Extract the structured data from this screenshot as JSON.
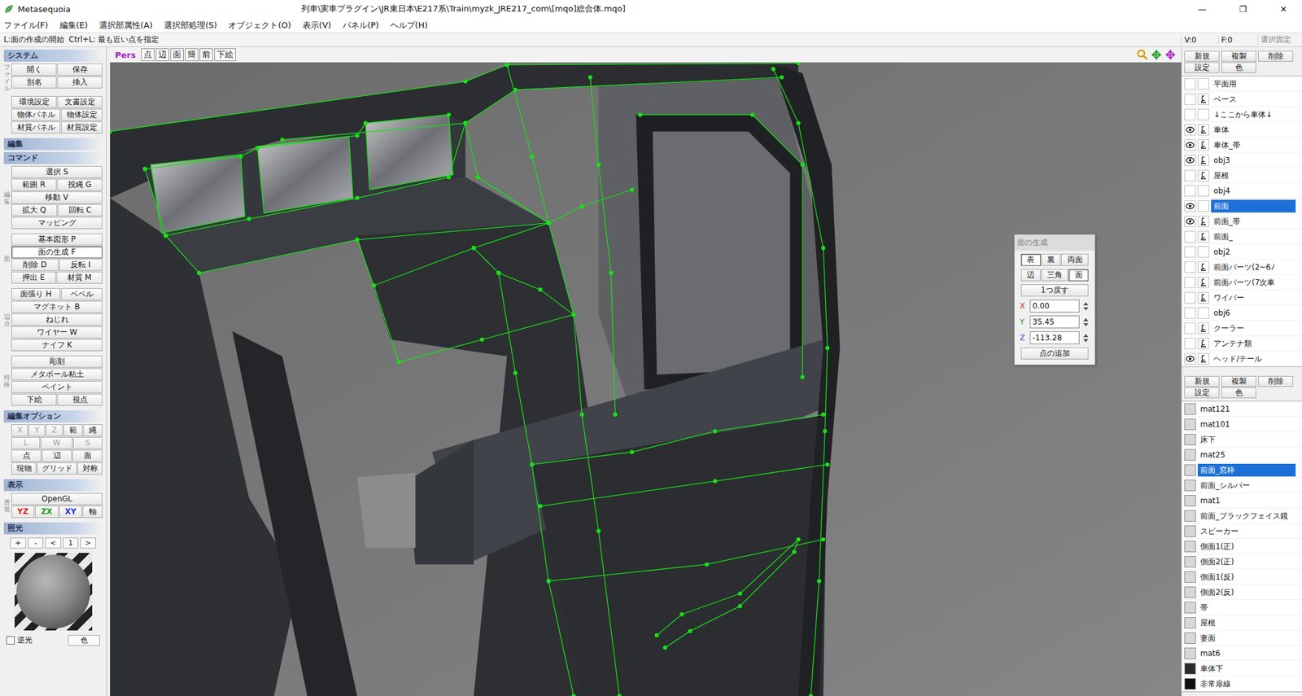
{
  "window": {
    "app": "Metasequoia",
    "path": "列車\\実車プラグイン\\JR東日本\\E217系\\Train\\myzk_JRE217_com\\[mqo]総合体.mqo]",
    "controls": [
      "—",
      "❐",
      "✕"
    ]
  },
  "menu": [
    "ファイル(F)",
    "編集(E)",
    "選択部属性(A)",
    "選択部処理(S)",
    "オブジェクト(O)",
    "表示(V)",
    "パネル(P)",
    "ヘルプ(H)"
  ],
  "status": {
    "hint": "L:面の作成の開始  Ctrl+L: 最も近い点を指定",
    "vertices": "V:0",
    "faces": "F:0",
    "lock": "選択固定"
  },
  "left_panel": {
    "sections": [
      {
        "title": "システム",
        "subtitle": "",
        "groups": [
          {
            "label": "ファイル",
            "rows": [
              [
                {
                  "label": "開く",
                  "selected": false,
                  "disabled": false
                },
                {
                  "label": "保存",
                  "selected": false,
                  "disabled": false
                }
              ],
              [
                {
                  "label": "別名",
                  "selected": false,
                  "disabled": false
                },
                {
                  "label": "挿入",
                  "selected": false,
                  "disabled": false
                }
              ]
            ]
          },
          {
            "label": "",
            "rows": [
              [
                {
                  "label": "環境設定",
                  "selected": false,
                  "disabled": false
                },
                {
                  "label": "文書設定",
                  "selected": false,
                  "disabled": false
                }
              ],
              [
                {
                  "label": "物体パネル",
                  "selected": false,
                  "disabled": false
                },
                {
                  "label": "物体設定",
                  "selected": false,
                  "disabled": false
                }
              ],
              [
                {
                  "label": "材質パネル",
                  "selected": false,
                  "disabled": false
                },
                {
                  "label": "材質設定",
                  "selected": false,
                  "disabled": false
                }
              ]
            ]
          }
        ]
      },
      {
        "title": "編集",
        "subtitle": "コマンド",
        "groups": [
          {
            "label": "編集",
            "rows": [
              [
                {
                  "label": "選択 S",
                  "selected": false,
                  "disabled": false
                }
              ],
              [
                {
                  "label": "範囲 R",
                  "selected": false,
                  "disabled": false
                },
                {
                  "label": "投縄 G",
                  "selected": false,
                  "disabled": false
                }
              ],
              [
                {
                  "label": "移動 V",
                  "selected": false,
                  "disabled": false
                }
              ],
              [
                {
                  "label": "拡大 Q",
                  "selected": false,
                  "disabled": false
                },
                {
                  "label": "回転 C",
                  "selected": false,
                  "disabled": false
                }
              ],
              [
                {
                  "label": "マッピング",
                  "selected": false,
                  "disabled": false
                }
              ]
            ]
          },
          {
            "label": "面",
            "rows": [
              [
                {
                  "label": "基本図形 P",
                  "selected": false,
                  "disabled": false
                }
              ],
              [
                {
                  "label": "面の生成 F",
                  "selected": true,
                  "disabled": false
                }
              ],
              [
                {
                  "label": "削除 D",
                  "selected": false,
                  "disabled": false
                },
                {
                  "label": "反転 I",
                  "selected": false,
                  "disabled": false
                }
              ],
              [
                {
                  "label": "押出 E",
                  "selected": false,
                  "disabled": false
                },
                {
                  "label": "材質 M",
                  "selected": false,
                  "disabled": false
                }
              ]
            ]
          },
          {
            "label": "辺・点",
            "rows": [
              [
                {
                  "label": "面張り H",
                  "selected": false,
                  "disabled": false
                },
                {
                  "label": "ベベル",
                  "selected": false,
                  "disabled": false
                }
              ],
              [
                {
                  "label": "マグネット B",
                  "selected": false,
                  "disabled": false
                }
              ],
              [
                {
                  "label": "ねじれ",
                  "selected": false,
                  "disabled": false
                }
              ],
              [
                {
                  "label": "ワイヤー W",
                  "selected": false,
                  "disabled": false
                }
              ],
              [
                {
                  "label": "ナイフ K",
                  "selected": false,
                  "disabled": false
                }
              ]
            ]
          },
          {
            "label": "特殊",
            "rows": [
              [
                {
                  "label": "彫刻",
                  "selected": false,
                  "disabled": false
                }
              ],
              [
                {
                  "label": "メタボール粘土",
                  "selected": false,
                  "disabled": false
                }
              ],
              [
                {
                  "label": "ペイント",
                  "selected": false,
                  "disabled": false
                }
              ],
              [
                {
                  "label": "下絵",
                  "selected": false,
                  "disabled": false
                },
                {
                  "label": "視点",
                  "selected": false,
                  "disabled": false
                }
              ]
            ]
          }
        ]
      },
      {
        "title": "編集オプション",
        "subtitle": "",
        "groups": [
          {
            "label": "",
            "rows": [
              [
                {
                  "label": "X",
                  "selected": false,
                  "disabled": true
                },
                {
                  "label": "Y",
                  "selected": false,
                  "disabled": true
                },
                {
                  "label": "Z",
                  "selected": false,
                  "disabled": true
                },
                {
                  "label": "範",
                  "selected": false,
                  "disabled": false
                },
                {
                  "label": "縄",
                  "selected": false,
                  "disabled": false
                }
              ],
              [
                {
                  "label": "L",
                  "selected": false,
                  "disabled": true
                },
                {
                  "label": "W",
                  "selected": false,
                  "disabled": true
                },
                {
                  "label": "S",
                  "selected": false,
                  "disabled": true
                }
              ],
              [
                {
                  "label": "点",
                  "selected": false,
                  "disabled": false
                },
                {
                  "label": "辺",
                  "selected": false,
                  "disabled": false
                },
                {
                  "label": "面",
                  "selected": false,
                  "disabled": false
                }
              ],
              [
                {
                  "label": "現物",
                  "selected": false,
                  "disabled": false
                },
                {
                  "label": "グリッド",
                  "selected": false,
                  "disabled": false
                },
                {
                  "label": "対称",
                  "selected": false,
                  "disabled": false
                }
              ]
            ]
          }
        ]
      },
      {
        "title": "表示",
        "subtitle": "",
        "groups": [
          {
            "label": "透視",
            "rows": [
              [
                {
                  "label": "OpenGL",
                  "selected": false,
                  "disabled": false
                }
              ],
              [
                {
                  "label": "YZ",
                  "selected": false,
                  "disabled": false,
                  "color": "#e02020"
                },
                {
                  "label": "ZX",
                  "selected": false,
                  "disabled": false,
                  "color": "#18a018"
                },
                {
                  "label": "XY",
                  "selected": false,
                  "disabled": false,
                  "color": "#2030e0"
                },
                {
                  "label": "軸",
                  "selected": false,
                  "disabled": false
                }
              ]
            ]
          }
        ]
      }
    ],
    "lighting": {
      "title": "照光",
      "controls": [
        "+",
        "-",
        "<",
        "1",
        ">"
      ],
      "backlight": {
        "label": "逆光",
        "checked": false
      },
      "color_button": "色"
    }
  },
  "viewport": {
    "view": "Pers",
    "buttons": [
      {
        "label": "点",
        "selected": false
      },
      {
        "label": "辺",
        "selected": false
      },
      {
        "label": "面",
        "selected": false
      },
      {
        "label": "簡",
        "selected": false
      },
      {
        "label": "前",
        "selected": false
      },
      {
        "label": "下絵",
        "selected": false
      }
    ]
  },
  "face_panel": {
    "title": "面の生成",
    "sides": [
      {
        "label": "表",
        "selected": true
      },
      {
        "label": "裏",
        "selected": false
      },
      {
        "label": "両面",
        "selected": false
      }
    ],
    "modes": [
      {
        "label": "辺",
        "selected": false
      },
      {
        "label": "三角",
        "selected": false
      },
      {
        "label": "面",
        "selected": true
      }
    ],
    "undo": "1つ戻す",
    "coords": [
      {
        "axis": "X",
        "value": "0.00",
        "color": "#e03030"
      },
      {
        "axis": "Y",
        "value": "35.45",
        "color": "#28a028"
      },
      {
        "axis": "Z",
        "value": "-113.28",
        "color": "#3050e0"
      }
    ],
    "add": "点の追加"
  },
  "objects": {
    "buttons": [
      "新規",
      "複製",
      "削除",
      "設定",
      "色"
    ],
    "items": [
      {
        "name": "平面用",
        "visible": false,
        "locked": false,
        "selected": false
      },
      {
        "name": "ベース",
        "visible": false,
        "locked": true,
        "selected": false
      },
      {
        "name": "↓ここから車体↓",
        "visible": false,
        "locked": false,
        "selected": false
      },
      {
        "name": "車体",
        "visible": true,
        "locked": true,
        "selected": false
      },
      {
        "name": "車体_帯",
        "visible": true,
        "locked": true,
        "selected": false
      },
      {
        "name": "obj3",
        "visible": true,
        "locked": true,
        "selected": false
      },
      {
        "name": "屋根",
        "visible": false,
        "locked": true,
        "selected": false
      },
      {
        "name": "obj4",
        "visible": false,
        "locked": false,
        "selected": false
      },
      {
        "name": "前面",
        "visible": true,
        "locked": false,
        "selected": true
      },
      {
        "name": "前面_帯",
        "visible": true,
        "locked": true,
        "selected": false
      },
      {
        "name": "前面_",
        "visible": false,
        "locked": true,
        "selected": false
      },
      {
        "name": "obj2",
        "visible": false,
        "locked": false,
        "selected": false
      },
      {
        "name": "前面パーツ(2~6ﾉ",
        "visible": false,
        "locked": true,
        "selected": false
      },
      {
        "name": "前面パーツ(7次車",
        "visible": false,
        "locked": true,
        "selected": false
      },
      {
        "name": "ワイパー",
        "visible": false,
        "locked": true,
        "selected": false
      },
      {
        "name": "obj6",
        "visible": false,
        "locked": false,
        "selected": false
      },
      {
        "name": "クーラー",
        "visible": false,
        "locked": true,
        "selected": false
      },
      {
        "name": "アンテナ類",
        "visible": false,
        "locked": true,
        "selected": false
      },
      {
        "name": "ヘッド/テール",
        "visible": true,
        "locked": true,
        "selected": false
      }
    ]
  },
  "materials": {
    "buttons": [
      "新規",
      "複製",
      "削除",
      "設定",
      "色"
    ],
    "items": [
      {
        "name": "mat121",
        "selected": false,
        "color": "#d8d8d8"
      },
      {
        "name": "mat101",
        "selected": false,
        "color": "#d8d8d8"
      },
      {
        "name": "床下",
        "selected": false,
        "color": "#d8d8d8"
      },
      {
        "name": "mat25",
        "selected": false,
        "color": "#d8d8d8"
      },
      {
        "name": "前面_窓枠",
        "selected": true,
        "color": "#d8d8d8"
      },
      {
        "name": "前面_シルバー",
        "selected": false,
        "color": "#d8d8d8"
      },
      {
        "name": "mat1",
        "selected": false,
        "color": "#d8d8d8"
      },
      {
        "name": "前面_ブラックフェイス鏡",
        "selected": false,
        "color": "#d8d8d8"
      },
      {
        "name": "スピーカー",
        "selected": false,
        "color": "#d8d8d8"
      },
      {
        "name": "側面1(正)",
        "selected": false,
        "color": "#d8d8d8"
      },
      {
        "name": "側面2(正)",
        "selected": false,
        "color": "#d8d8d8"
      },
      {
        "name": "側面1(反)",
        "selected": false,
        "color": "#d8d8d8"
      },
      {
        "name": "側面2(反)",
        "selected": false,
        "color": "#d8d8d8"
      },
      {
        "name": "帯",
        "selected": false,
        "color": "#d8d8d8"
      },
      {
        "name": "屋根",
        "selected": false,
        "color": "#d8d8d8"
      },
      {
        "name": "妻面",
        "selected": false,
        "color": "#d8d8d8"
      },
      {
        "name": "mat6",
        "selected": false,
        "color": "#d8d8d8"
      },
      {
        "name": "車体下",
        "selected": false,
        "color": "#2a2a2a"
      },
      {
        "name": "非常扉線",
        "selected": false,
        "color": "#101010"
      }
    ]
  }
}
